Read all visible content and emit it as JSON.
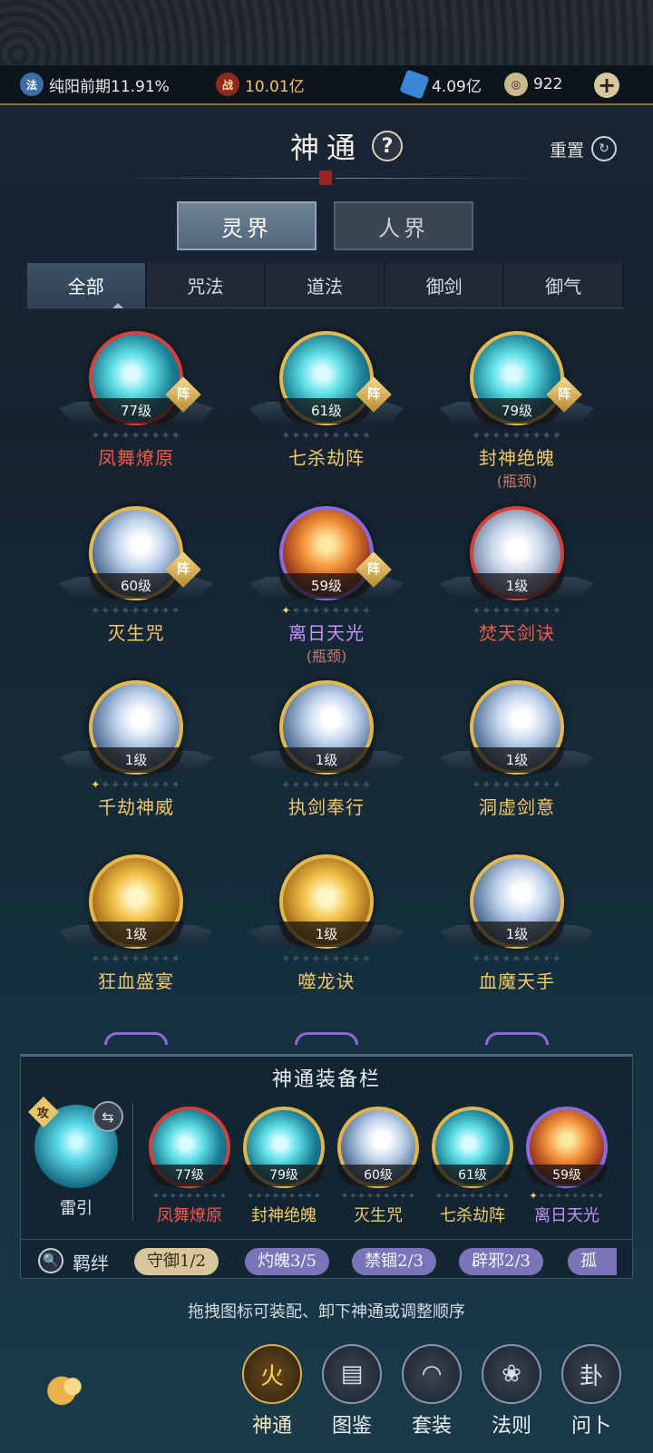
{
  "resources": {
    "cultivation": {
      "icon": "dharma-icon",
      "text": "纯阳前期11.91%"
    },
    "power": {
      "icon": "battle-icon",
      "text": "10.01亿"
    },
    "crystal": {
      "icon": "spirit-crystal-icon",
      "text": "4.09亿"
    },
    "gold": {
      "icon": "coin-icon",
      "text": "922"
    },
    "plus": "+"
  },
  "header": {
    "title": "神通",
    "help": "?",
    "reset_label": "重置"
  },
  "realm_tabs": [
    {
      "label": "灵界",
      "active": true
    },
    {
      "label": "人界",
      "active": false
    }
  ],
  "categories": [
    {
      "label": "全部",
      "active": true
    },
    {
      "label": "咒法",
      "active": false
    },
    {
      "label": "道法",
      "active": false
    },
    {
      "label": "御剑",
      "active": false
    },
    {
      "label": "御气",
      "active": false
    }
  ],
  "skills": [
    {
      "name": "凤舞燎原",
      "level": "77级",
      "zhen": "阵",
      "sub": ""
    },
    {
      "name": "七杀劫阵",
      "level": "61级",
      "zhen": "阵",
      "sub": ""
    },
    {
      "name": "封神绝魄",
      "level": "79级",
      "zhen": "阵",
      "sub": "(瓶颈)"
    },
    {
      "name": "灭生咒",
      "level": "60级",
      "zhen": "阵",
      "sub": ""
    },
    {
      "name": "离日天光",
      "level": "59级",
      "zhen": "阵",
      "sub": "(瓶颈)"
    },
    {
      "name": "焚天剑诀",
      "level": "1级",
      "zhen": "",
      "sub": ""
    },
    {
      "name": "千劫神威",
      "level": "1级",
      "zhen": "",
      "sub": ""
    },
    {
      "name": "执剑奉行",
      "level": "1级",
      "zhen": "",
      "sub": ""
    },
    {
      "name": "洞虚剑意",
      "level": "1级",
      "zhen": "",
      "sub": ""
    },
    {
      "name": "狂血盛宴",
      "level": "1级",
      "zhen": "",
      "sub": ""
    },
    {
      "name": "噬龙诀",
      "level": "1级",
      "zhen": "",
      "sub": ""
    },
    {
      "name": "血魔天手",
      "level": "1级",
      "zhen": "",
      "sub": ""
    }
  ],
  "equip_panel": {
    "title": "神通装备栏",
    "main_skill": {
      "name": "雷引",
      "badge": "攻",
      "swap_icon": "swap-icon"
    },
    "slots": [
      {
        "name": "凤舞燎原",
        "level": "77级"
      },
      {
        "name": "封神绝魄",
        "level": "79级"
      },
      {
        "name": "灭生咒",
        "level": "60级"
      },
      {
        "name": "七杀劫阵",
        "level": "61级"
      },
      {
        "name": "离日天光",
        "level": "59级"
      }
    ],
    "bond_label": "羁绊",
    "bonds": [
      "守御1/2",
      "灼魄3/5",
      "禁锢2/3",
      "辟邪2/3",
      "孤"
    ]
  },
  "hint": "拖拽图标可装配、卸下神通或调整顺序",
  "bottom_nav": [
    {
      "label": "神通",
      "icon": "flame-icon",
      "active": true
    },
    {
      "label": "图鉴",
      "icon": "book-icon",
      "active": false
    },
    {
      "label": "套装",
      "icon": "fan-icon",
      "active": false
    },
    {
      "label": "法则",
      "icon": "lotus-icon",
      "active": false
    },
    {
      "label": "问卜",
      "icon": "divination-icon",
      "active": false
    }
  ],
  "colors": {
    "accent_gold": "#e0b44a",
    "rarity_red": "#f25a4e",
    "rarity_purple": "#c592ff",
    "rarity_gold": "#f2c86a"
  }
}
